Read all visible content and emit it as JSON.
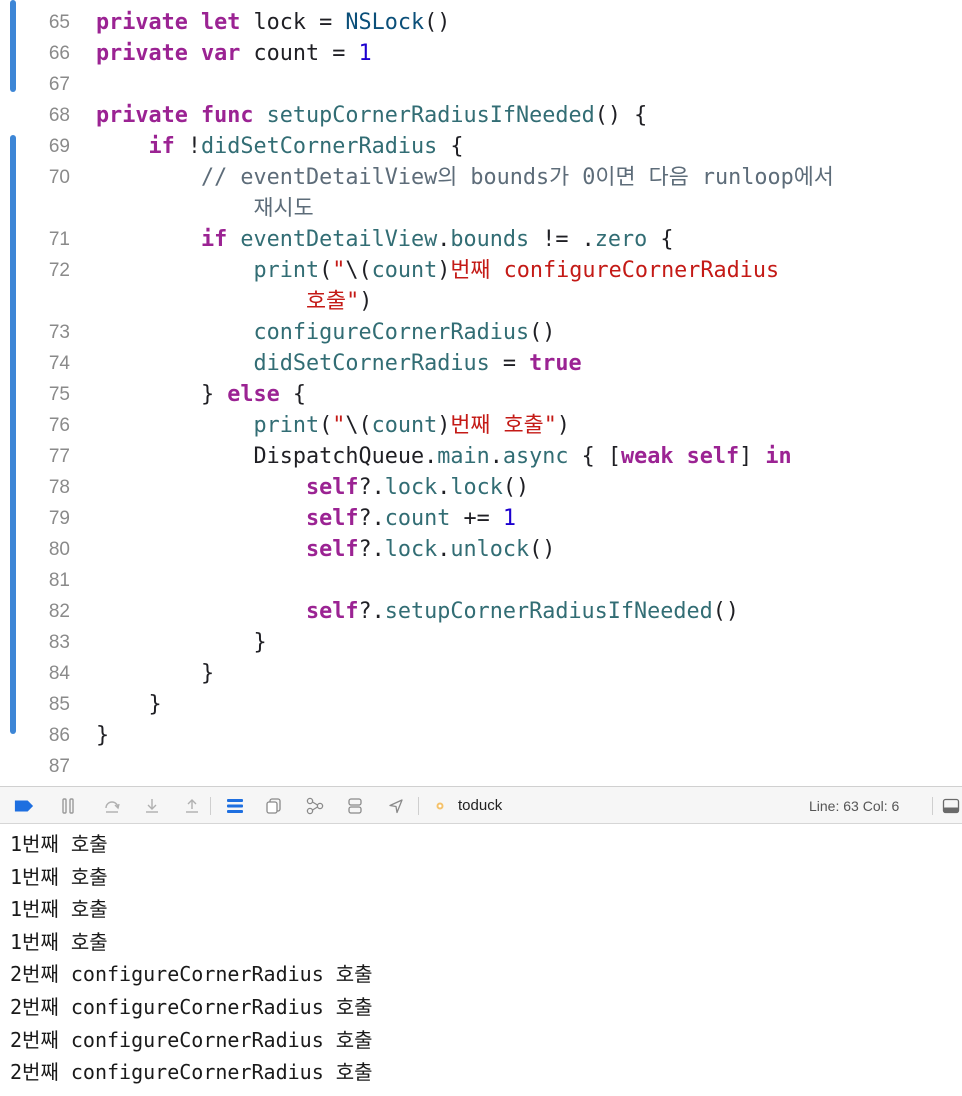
{
  "editor": {
    "lines": [
      {
        "num": "65",
        "tokens": [
          [
            "private",
            "kw"
          ],
          [
            " ",
            "pl"
          ],
          [
            "let",
            "kw"
          ],
          [
            " lock = ",
            "pl"
          ],
          [
            "NSLock",
            "typ"
          ],
          [
            "()",
            "pl"
          ]
        ],
        "cont": []
      },
      {
        "num": "66",
        "tokens": [
          [
            "private",
            "kw"
          ],
          [
            " ",
            "pl"
          ],
          [
            "var",
            "kw"
          ],
          [
            " count = ",
            "pl"
          ],
          [
            "1",
            "num"
          ]
        ],
        "cont": []
      },
      {
        "num": "67",
        "tokens": [],
        "cont": []
      },
      {
        "num": "68",
        "tokens": [
          [
            "private",
            "kw"
          ],
          [
            " ",
            "pl"
          ],
          [
            "func",
            "kw"
          ],
          [
            " ",
            "pl"
          ],
          [
            "setupCornerRadiusIfNeeded",
            "fn"
          ],
          [
            "() {",
            "pl"
          ]
        ],
        "cont": []
      },
      {
        "num": "69",
        "tokens": [
          [
            "    ",
            "pl"
          ],
          [
            "if",
            "kw"
          ],
          [
            " !",
            "pl"
          ],
          [
            "didSetCornerRadius",
            "fn"
          ],
          [
            " {",
            "pl"
          ]
        ],
        "cont": []
      },
      {
        "num": "70",
        "tokens": [
          [
            "        ",
            "pl"
          ],
          [
            "// eventDetailView의 bounds가 0이면 다음 runloop에서",
            "cmt"
          ]
        ],
        "cont": [
          [
            "재시도",
            "cmt"
          ]
        ]
      },
      {
        "num": "71",
        "tokens": [
          [
            "        ",
            "pl"
          ],
          [
            "if",
            "kw"
          ],
          [
            " ",
            "pl"
          ],
          [
            "eventDetailView",
            "fn"
          ],
          [
            ".",
            "pl"
          ],
          [
            "bounds",
            "fn"
          ],
          [
            " != .",
            "pl"
          ],
          [
            "zero",
            "fn"
          ],
          [
            " {",
            "pl"
          ]
        ],
        "cont": []
      },
      {
        "num": "72",
        "tokens": [
          [
            "            ",
            "pl"
          ],
          [
            "print",
            "fn"
          ],
          [
            "(",
            "pl"
          ],
          [
            "\"",
            "str"
          ],
          [
            "\\(",
            "pl"
          ],
          [
            "count",
            "fn"
          ],
          [
            ")",
            "pl"
          ],
          [
            "번째 configureCornerRadius",
            "str"
          ]
        ],
        "cont": [
          [
            "호출\"",
            "str"
          ],
          [
            ")",
            "pl"
          ]
        ]
      },
      {
        "num": "73",
        "tokens": [
          [
            "            ",
            "pl"
          ],
          [
            "configureCornerRadius",
            "fn"
          ],
          [
            "()",
            "pl"
          ]
        ],
        "cont": []
      },
      {
        "num": "74",
        "tokens": [
          [
            "            ",
            "pl"
          ],
          [
            "didSetCornerRadius",
            "fn"
          ],
          [
            " = ",
            "pl"
          ],
          [
            "true",
            "kw"
          ]
        ],
        "cont": []
      },
      {
        "num": "75",
        "tokens": [
          [
            "        } ",
            "pl"
          ],
          [
            "else",
            "kw"
          ],
          [
            " {",
            "pl"
          ]
        ],
        "cont": []
      },
      {
        "num": "76",
        "tokens": [
          [
            "            ",
            "pl"
          ],
          [
            "print",
            "fn"
          ],
          [
            "(",
            "pl"
          ],
          [
            "\"",
            "str"
          ],
          [
            "\\(",
            "pl"
          ],
          [
            "count",
            "fn"
          ],
          [
            ")",
            "pl"
          ],
          [
            "번째 호출\"",
            "str"
          ],
          [
            ")",
            "pl"
          ]
        ],
        "cont": []
      },
      {
        "num": "77",
        "tokens": [
          [
            "            DispatchQueue.",
            "pl"
          ],
          [
            "main",
            "fn"
          ],
          [
            ".",
            "pl"
          ],
          [
            "async",
            "fn"
          ],
          [
            " { [",
            "pl"
          ],
          [
            "weak",
            "kw"
          ],
          [
            " ",
            "pl"
          ],
          [
            "self",
            "kw"
          ],
          [
            "] ",
            "pl"
          ],
          [
            "in",
            "kw"
          ]
        ],
        "cont": []
      },
      {
        "num": "78",
        "tokens": [
          [
            "                ",
            "pl"
          ],
          [
            "self",
            "kw"
          ],
          [
            "?.",
            "pl"
          ],
          [
            "lock",
            "fn"
          ],
          [
            ".",
            "pl"
          ],
          [
            "lock",
            "fn"
          ],
          [
            "()",
            "pl"
          ]
        ],
        "cont": []
      },
      {
        "num": "79",
        "tokens": [
          [
            "                ",
            "pl"
          ],
          [
            "self",
            "kw"
          ],
          [
            "?.",
            "pl"
          ],
          [
            "count",
            "fn"
          ],
          [
            " += ",
            "pl"
          ],
          [
            "1",
            "num"
          ]
        ],
        "cont": []
      },
      {
        "num": "80",
        "tokens": [
          [
            "                ",
            "pl"
          ],
          [
            "self",
            "kw"
          ],
          [
            "?.",
            "pl"
          ],
          [
            "lock",
            "fn"
          ],
          [
            ".",
            "pl"
          ],
          [
            "unlock",
            "fn"
          ],
          [
            "()",
            "pl"
          ]
        ],
        "cont": []
      },
      {
        "num": "81",
        "tokens": [],
        "cont": []
      },
      {
        "num": "82",
        "tokens": [
          [
            "                ",
            "pl"
          ],
          [
            "self",
            "kw"
          ],
          [
            "?.",
            "pl"
          ],
          [
            "setupCornerRadiusIfNeeded",
            "fn"
          ],
          [
            "()",
            "pl"
          ]
        ],
        "cont": []
      },
      {
        "num": "83",
        "tokens": [
          [
            "            }",
            "pl"
          ]
        ],
        "cont": []
      },
      {
        "num": "84",
        "tokens": [
          [
            "        }",
            "pl"
          ]
        ],
        "cont": []
      },
      {
        "num": "85",
        "tokens": [
          [
            "    }",
            "pl"
          ]
        ],
        "cont": []
      },
      {
        "num": "86",
        "tokens": [
          [
            "}",
            "pl"
          ]
        ],
        "cont": []
      },
      {
        "num": "87",
        "tokens": [],
        "cont": []
      }
    ]
  },
  "debug_bar": {
    "icons": [
      "breakpoints-toggle-icon",
      "pause-icon",
      "step-over-icon",
      "step-into-icon",
      "step-out-icon",
      "view-hierarchy-icon",
      "memory-graph-icon",
      "environment-overrides-icon",
      "simulate-location-icon",
      "location-icon",
      "app-target-icon",
      "console-toggle-icon"
    ],
    "scheme": "toduck",
    "line_info": "Line: 63  Col: 6"
  },
  "console": {
    "lines": [
      "1번째 호출",
      "1번째 호출",
      "1번째 호출",
      "1번째 호출",
      "2번째 configureCornerRadius 호출",
      "2번째 configureCornerRadius 호출",
      "2번째 configureCornerRadius 호출",
      "2번째 configureCornerRadius 호출"
    ]
  },
  "colors": {
    "keyword": "#9b2393",
    "type": "#0b4f79",
    "function": "#326d74",
    "number": "#1c00cf",
    "string": "#c41a16",
    "comment": "#5d6c79",
    "accent": "#1e6fe0"
  }
}
